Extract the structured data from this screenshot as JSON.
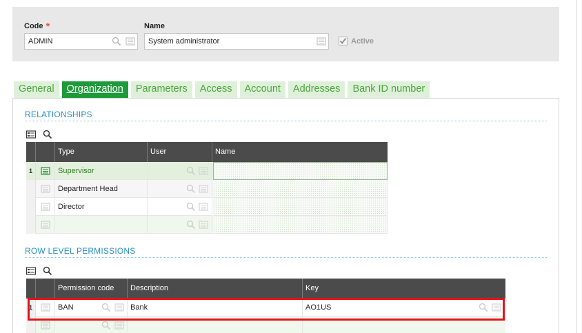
{
  "header": {
    "code_label": "Code",
    "required_mark": "*",
    "code_value": "ADMIN",
    "name_label": "Name",
    "name_value": "System administrator",
    "active_label": "Active",
    "active_checked": true
  },
  "tabs": [
    {
      "label": "General",
      "active": false
    },
    {
      "label": "Organization",
      "active": true
    },
    {
      "label": "Parameters",
      "active": false
    },
    {
      "label": "Access",
      "active": false
    },
    {
      "label": "Account",
      "active": false
    },
    {
      "label": "Addresses",
      "active": false
    },
    {
      "label": "Bank ID number",
      "active": false
    }
  ],
  "relationships": {
    "title": "RELATIONSHIPS",
    "columns": [
      "Type",
      "User",
      "Name"
    ],
    "rows": [
      {
        "num": "1",
        "type": "Supervisor",
        "user": "",
        "name": ""
      },
      {
        "num": "",
        "type": "Department Head",
        "user": "",
        "name": ""
      },
      {
        "num": "",
        "type": "Director",
        "user": "",
        "name": ""
      },
      {
        "num": "",
        "type": "",
        "user": "",
        "name": ""
      }
    ]
  },
  "row_level_permissions": {
    "title": "ROW LEVEL PERMISSIONS",
    "columns": [
      "Permission code",
      "Description",
      "Key"
    ],
    "rows": [
      {
        "num": "1",
        "code": "BAN",
        "description": "Bank",
        "key": "AO1US"
      },
      {
        "num": "",
        "code": "",
        "description": "",
        "key": ""
      }
    ]
  },
  "colors": {
    "tab_active_bg": "#1e9a3a",
    "tab_inactive_bg": "#dff0da",
    "tab_text": "#4aa63a",
    "section_title": "#2a8fc2",
    "grid_header_bg": "#4b4b4b",
    "selected_row_bg": "#e2f0dd",
    "selected_row_text": "#2e7d1f",
    "highlight": "#e3131b"
  }
}
